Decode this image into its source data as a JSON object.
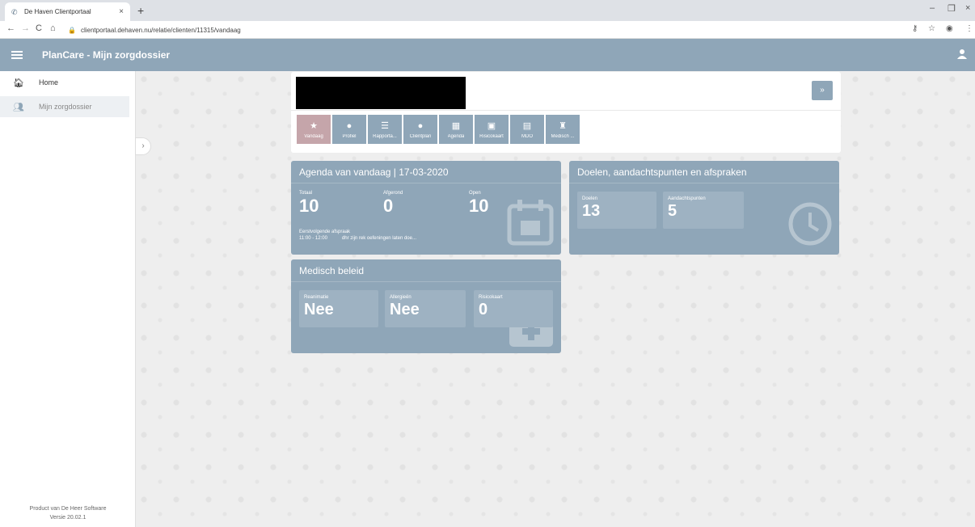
{
  "browser": {
    "tab_title": "De Haven Clientportaal",
    "tab_close": "×",
    "new_tab": "+",
    "url": "clientportaal.dehaven.nu/relatie/clienten/11315/vandaag",
    "back": "←",
    "forward": "→",
    "reload": "C",
    "home": "⌂",
    "minimize": "–",
    "maximize": "❐",
    "close": "×"
  },
  "app": {
    "title": "PlanCare - Mijn zorgdossier"
  },
  "sidebar": {
    "items": [
      {
        "label": "Home",
        "icon": "home-icon"
      },
      {
        "label": "Mijn zorgdossier",
        "icon": "people-icon"
      }
    ],
    "footer_line1": "Product van De Heer Software",
    "footer_line2": "Versie 20.02.1"
  },
  "client": {
    "tiles": [
      {
        "label": "Vandaag",
        "icon": "star-icon",
        "glyph": "★"
      },
      {
        "label": "Profiel",
        "icon": "person-icon",
        "glyph": "👤"
      },
      {
        "label": "Rapporta...",
        "icon": "list-icon",
        "glyph": "☰"
      },
      {
        "label": "Cliëntplan",
        "icon": "user-plan-icon",
        "glyph": "👤"
      },
      {
        "label": "Agenda",
        "icon": "calendar-icon",
        "glyph": "▦"
      },
      {
        "label": "Risicokaart",
        "icon": "image-icon",
        "glyph": "▣"
      },
      {
        "label": "MDO",
        "icon": "document-icon",
        "glyph": "▤"
      },
      {
        "label": "Medisch ...",
        "icon": "medical-icon",
        "glyph": "♜"
      }
    ]
  },
  "agenda": {
    "title": "Agenda van vandaag | 17-03-2020",
    "totaal_label": "Totaal",
    "totaal": "10",
    "afgerond_label": "Afgerond",
    "afgerond": "0",
    "open_label": "Open",
    "open": "10",
    "next_label": "Eerstvolgende afspraak",
    "next_time": "11:00 - 12:00",
    "next_desc": "dhr zijn rek oefeningen laten doe..."
  },
  "doelen": {
    "title": "Doelen, aandachtspunten en afspraken",
    "doelen_label": "Doelen",
    "doelen": "13",
    "aandacht_label": "Aandachtspunten",
    "aandacht": "5"
  },
  "medisch": {
    "title": "Medisch beleid",
    "reanimatie_label": "Reanimatie",
    "reanimatie": "Nee",
    "allergie_label": "Allergieën",
    "allergie": "Nee",
    "risico_label": "Risicokaart",
    "risico": "0"
  },
  "colors": {
    "header": "#8fa6b8",
    "active_tile": "#c5a5aa",
    "background": "#eeeeee"
  }
}
